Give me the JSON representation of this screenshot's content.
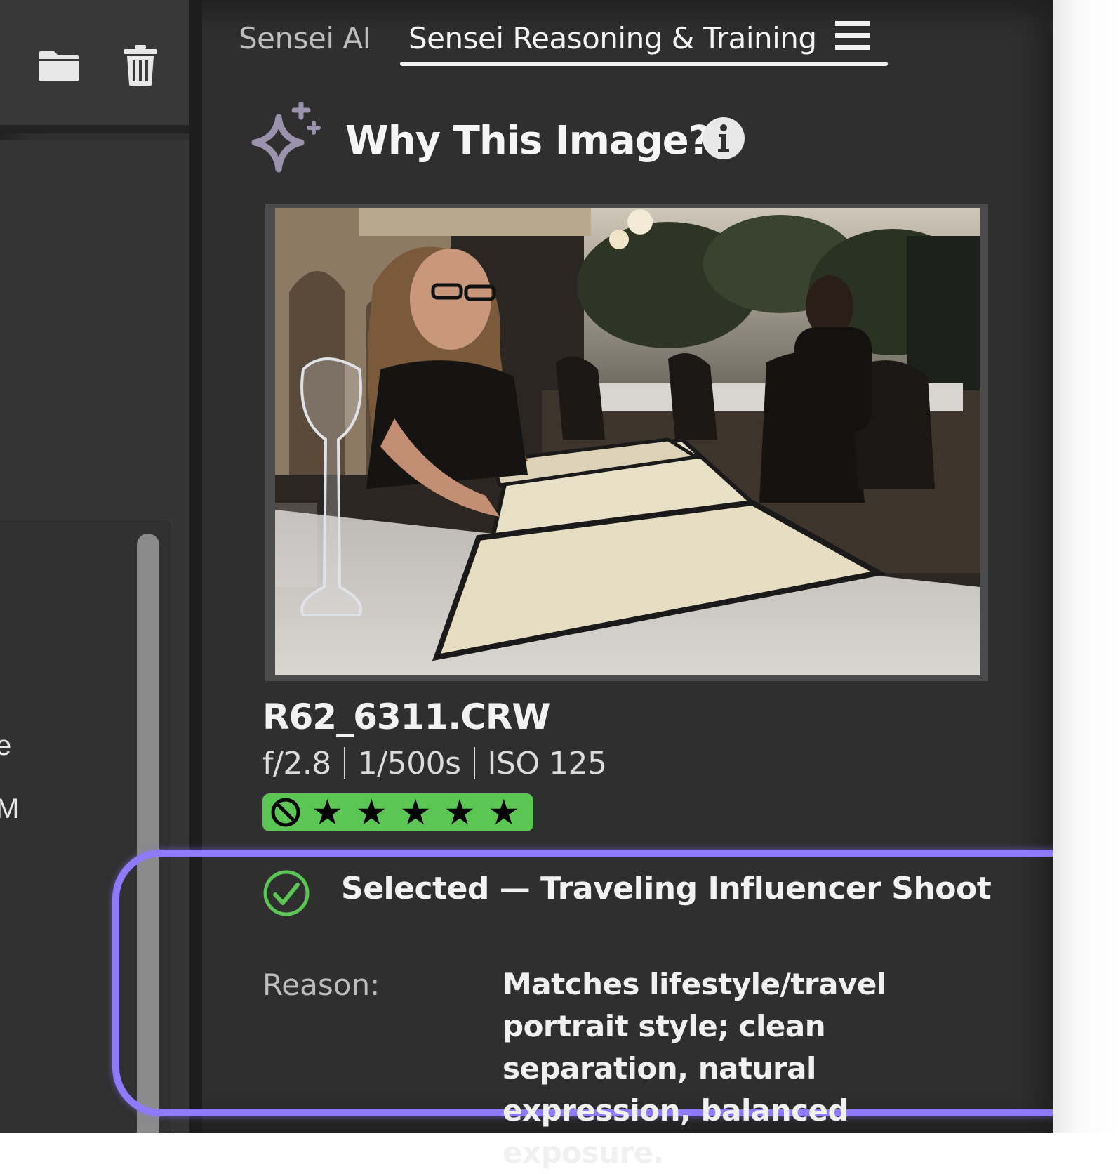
{
  "tabs": [
    {
      "label": "Sensei AI",
      "active": false
    },
    {
      "label": "Sensei Reasoning & Training",
      "active": true
    }
  ],
  "toolbar": {
    "icons": [
      "folder-icon",
      "trash-icon",
      "menu-icon"
    ]
  },
  "left_panel": {
    "fragment_1": "e",
    "fragment_2": "M"
  },
  "panel": {
    "title": "Why This Image?",
    "icons": [
      "sparkle-icon",
      "info-icon"
    ]
  },
  "image": {
    "filename": "R62_6311.CRW",
    "aperture": "f/2.8",
    "shutter": "1/500s",
    "iso": "ISO 125",
    "rating_stars": 5,
    "rating_display": "★",
    "flag_icon": "reject-icon",
    "rating_color": "#5cc655"
  },
  "result": {
    "status": "Selected — Traveling Influencer Shoot",
    "status_icon": "check-circle-icon",
    "status_color": "#5cc655",
    "reason_label": "Reason:",
    "reason_text": "Matches lifestyle/travel portrait style;  clean separation, natural expression, balanced exposure."
  },
  "highlight_color": "#8f79ff"
}
